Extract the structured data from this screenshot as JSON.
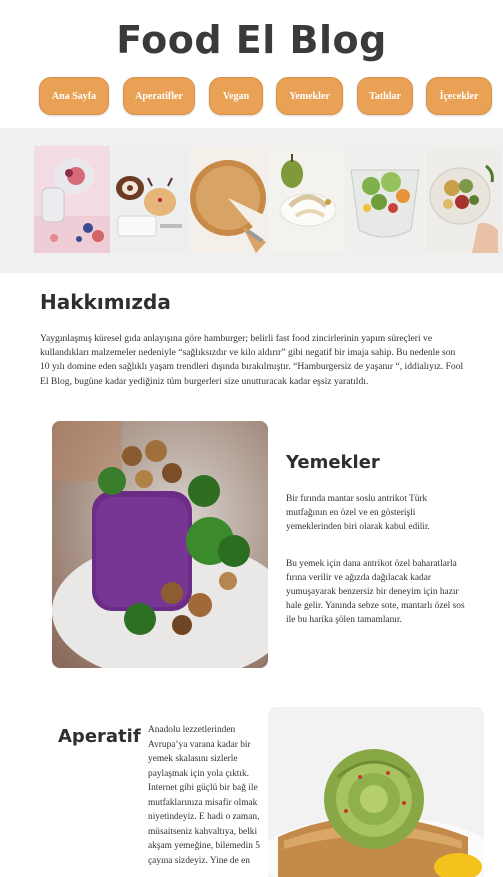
{
  "site": {
    "title": "Food El Blog"
  },
  "nav": {
    "items": [
      {
        "label": "Ana Sayfa"
      },
      {
        "label": "Aperatifler"
      },
      {
        "label": "Vegan"
      },
      {
        "label": "Yemekler"
      },
      {
        "label": "Tatlılar"
      },
      {
        "label": "İçecekler"
      }
    ]
  },
  "gallery": {
    "images": [
      "fruit-jar-photo",
      "cake-roll-dessert-photo",
      "pie-slice-photo",
      "pear-dessert-photo",
      "salad-glass-photo",
      "bowl-hand-photo"
    ]
  },
  "about": {
    "heading": "Hakkımızda",
    "text": "Yaygınlaşmış küresel gıda anlayışına göre hamburger; belirli fast food zincirlerinin yapım süreçleri ve kullandıkları malzemeler nedeniyle “sağlıksızdır ve kilo aldırır” gibi negatif bir imaja sahip. Bu nedenle son 10 yılı domine eden sağlıklı yaşam trendleri dışında bırakılmıştır. “Hamburgersiz de yaşanır “, iddialıyız. Fool El Blog, bugüne kadar yediğiniz tüm burgerleri size unutturacak kadar eşsiz yaratıldı."
  },
  "featured": {
    "heading": "Yemekler",
    "p1": "Bir fırında mantar soslu antrikot Türk mutfağının en özel ve en gösterişli yemeklerinden biri olarak kabul edilir.",
    "p2": "Bu yemek için dana antrikot özel baharatlarla fırına verilir ve ağızda dağılacak kadar yumuşayarak benzersiz bir deneyim için hazır hale gelir. Yanında sebze sote, mantarlı özel sos ile bu harika şölen tamamlanır.",
    "image": "purple-mash-mushroom-dish-photo"
  },
  "appetizer": {
    "heading": "Aperatif",
    "text": "Anadolu lezzetlerinden Avrupa’ya varana kadar bir yemek skalasını sizlerle paylaşmak için yola çıktık. Internet gibi güçlü bir bağ ile mutfaklarınıza misafir olmak niyetindeyiz. E hadi o zaman, müsaitseniz kahvaltıya, belki akşam yemeğine, bilemedin 5 çayına sizdeyiz. Yine de en",
    "image": "avocado-rose-toast-photo"
  },
  "colors": {
    "accent": "#e8a155",
    "strip_bg": "#f0f0f0"
  }
}
